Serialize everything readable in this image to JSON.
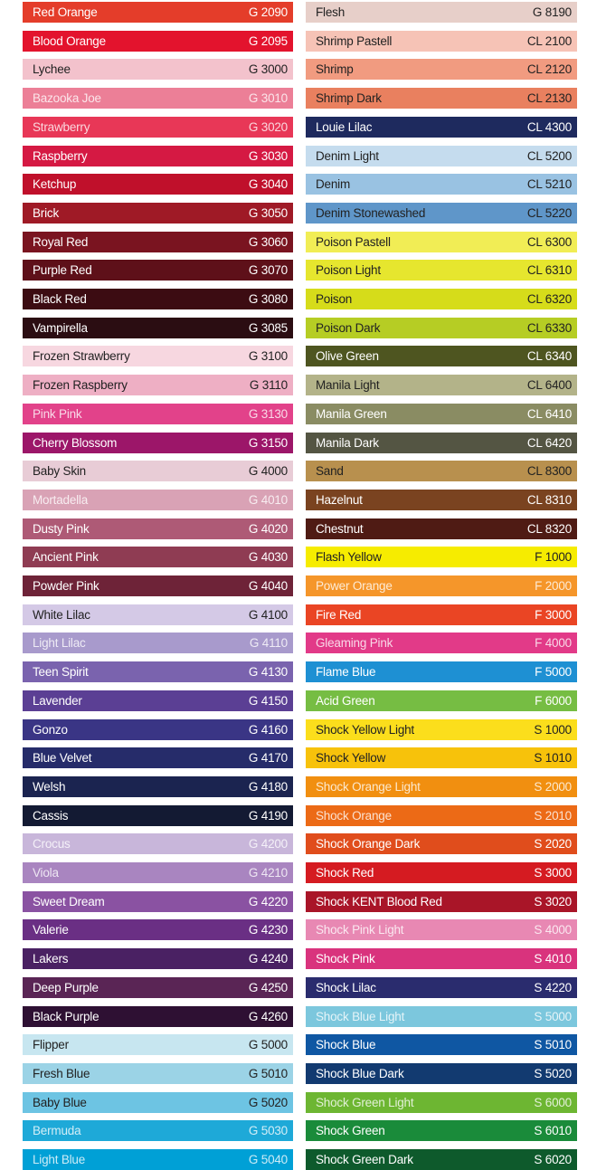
{
  "left_column": [
    {
      "name": "Red Orange",
      "code": "G 2090",
      "color": "#e43d2a",
      "text": "dark"
    },
    {
      "name": "Blood Orange",
      "code": "G 2095",
      "color": "#e3132d",
      "text": "dark"
    },
    {
      "name": "Lychee",
      "code": "G 3000",
      "color": "#f3c2cc",
      "text": "light"
    },
    {
      "name": "Bazooka Joe",
      "code": "G 3010",
      "color": "#ec7f97",
      "text": "faint"
    },
    {
      "name": "Strawberry",
      "code": "G 3020",
      "color": "#e83757",
      "text": "faint"
    },
    {
      "name": "Raspberry",
      "code": "G 3030",
      "color": "#d51943",
      "text": "dark"
    },
    {
      "name": "Ketchup",
      "code": "G 3040",
      "color": "#c0102b",
      "text": "dark"
    },
    {
      "name": "Brick",
      "code": "G 3050",
      "color": "#9f1a26",
      "text": "dark"
    },
    {
      "name": "Royal Red",
      "code": "G 3060",
      "color": "#7a1420",
      "text": "dark"
    },
    {
      "name": "Purple Red",
      "code": "G 3070",
      "color": "#5e1019",
      "text": "dark"
    },
    {
      "name": "Black Red",
      "code": "G 3080",
      "color": "#3c0c12",
      "text": "dark"
    },
    {
      "name": "Vampirella",
      "code": "G 3085",
      "color": "#2b0d12",
      "text": "dark"
    },
    {
      "name": "Frozen Strawberry",
      "code": "G 3100",
      "color": "#f7d7e0",
      "text": "light"
    },
    {
      "name": "Frozen Raspberry",
      "code": "G 3110",
      "color": "#eeafc4",
      "text": "light"
    },
    {
      "name": "Pink Pink",
      "code": "G 3130",
      "color": "#e2428a",
      "text": "faint"
    },
    {
      "name": "Cherry Blossom",
      "code": "G 3150",
      "color": "#9c1669",
      "text": "dark"
    },
    {
      "name": "Baby Skin",
      "code": "G 4000",
      "color": "#e8ccd6",
      "text": "light"
    },
    {
      "name": "Mortadella",
      "code": "G 4010",
      "color": "#d9a2b5",
      "text": "faint"
    },
    {
      "name": "Dusty Pink",
      "code": "G 4020",
      "color": "#ae5a76",
      "text": "dark"
    },
    {
      "name": "Ancient Pink",
      "code": "G 4030",
      "color": "#8f3c53",
      "text": "dark"
    },
    {
      "name": "Powder Pink",
      "code": "G 4040",
      "color": "#6e2338",
      "text": "dark"
    },
    {
      "name": "White Lilac",
      "code": "G 4100",
      "color": "#d4c9e6",
      "text": "light"
    },
    {
      "name": "Light Lilac",
      "code": "G 4110",
      "color": "#a89acc",
      "text": "faint"
    },
    {
      "name": "Teen Spirit",
      "code": "G 4130",
      "color": "#7a63ae",
      "text": "dark"
    },
    {
      "name": "Lavender",
      "code": "G 4150",
      "color": "#5b3f94",
      "text": "dark"
    },
    {
      "name": "Gonzo",
      "code": "G 4160",
      "color": "#3a3585",
      "text": "dark"
    },
    {
      "name": "Blue Velvet",
      "code": "G 4170",
      "color": "#262c6a",
      "text": "dark"
    },
    {
      "name": "Welsh",
      "code": "G 4180",
      "color": "#1b2450",
      "text": "dark"
    },
    {
      "name": "Cassis",
      "code": "G 4190",
      "color": "#131a33",
      "text": "dark"
    },
    {
      "name": "Crocus",
      "code": "G 4200",
      "color": "#c8b6da",
      "text": "faint"
    },
    {
      "name": "Viola",
      "code": "G 4210",
      "color": "#a985c0",
      "text": "faint"
    },
    {
      "name": "Sweet Dream",
      "code": "G 4220",
      "color": "#8a52a2",
      "text": "dark"
    },
    {
      "name": "Valerie",
      "code": "G 4230",
      "color": "#6a2f84",
      "text": "dark"
    },
    {
      "name": "Lakers",
      "code": "G 4240",
      "color": "#4a2163",
      "text": "dark"
    },
    {
      "name": "Deep Purple",
      "code": "G 4250",
      "color": "#5a2555",
      "text": "dark"
    },
    {
      "name": "Black Purple",
      "code": "G 4260",
      "color": "#2e1033",
      "text": "dark"
    },
    {
      "name": "Flipper",
      "code": "G 5000",
      "color": "#c7e6f0",
      "text": "light"
    },
    {
      "name": "Fresh Blue",
      "code": "G 5010",
      "color": "#9bd3e6",
      "text": "light"
    },
    {
      "name": "Baby Blue",
      "code": "G 5020",
      "color": "#6dc4e3",
      "text": "light"
    },
    {
      "name": "Bermuda",
      "code": "G 5030",
      "color": "#1ea9d8",
      "text": "faint"
    },
    {
      "name": "Light Blue",
      "code": "G 5040",
      "color": "#00a0d6",
      "text": "faint"
    }
  ],
  "right_column": [
    {
      "name": "Flesh",
      "code": "G 8190",
      "color": "#e7cfc9",
      "text": "light"
    },
    {
      "name": "Shrimp Pastell",
      "code": "CL 2100",
      "color": "#f6c3b6",
      "text": "light"
    },
    {
      "name": "Shrimp",
      "code": "CL 2120",
      "color": "#f19b80",
      "text": "light"
    },
    {
      "name": "Shrimp Dark",
      "code": "CL 2130",
      "color": "#e9805f",
      "text": "light"
    },
    {
      "name": "Louie Lilac",
      "code": "CL 4300",
      "color": "#1e2a5e",
      "text": "dark"
    },
    {
      "name": "Denim Light",
      "code": "CL 5200",
      "color": "#c5dcee",
      "text": "light"
    },
    {
      "name": "Denim",
      "code": "CL 5210",
      "color": "#99c2e2",
      "text": "light"
    },
    {
      "name": "Denim Stonewashed",
      "code": "CL 5220",
      "color": "#5f96c9",
      "text": "light"
    },
    {
      "name": "Poison Pastell",
      "code": "CL 6300",
      "color": "#f1ed55",
      "text": "light"
    },
    {
      "name": "Poison Light",
      "code": "CL 6310",
      "color": "#e6e62e",
      "text": "light"
    },
    {
      "name": "Poison",
      "code": "CL 6320",
      "color": "#d6dc1a",
      "text": "light"
    },
    {
      "name": "Poison Dark",
      "code": "CL 6330",
      "color": "#b6cd24",
      "text": "light"
    },
    {
      "name": "Olive Green",
      "code": "CL 6340",
      "color": "#4e5520",
      "text": "dark"
    },
    {
      "name": "Manila Light",
      "code": "CL 6400",
      "color": "#b3b389",
      "text": "light"
    },
    {
      "name": "Manila Green",
      "code": "CL 6410",
      "color": "#8a8c63",
      "text": "dark"
    },
    {
      "name": "Manila Dark",
      "code": "CL 6420",
      "color": "#545543",
      "text": "dark"
    },
    {
      "name": "Sand",
      "code": "CL 8300",
      "color": "#b8904e",
      "text": "light"
    },
    {
      "name": "Hazelnut",
      "code": "CL 8310",
      "color": "#7a4320",
      "text": "dark"
    },
    {
      "name": "Chestnut",
      "code": "CL 8320",
      "color": "#4f1b14",
      "text": "dark"
    },
    {
      "name": "Flash Yellow",
      "code": "F 1000",
      "color": "#f6ec00",
      "text": "light"
    },
    {
      "name": "Power Orange",
      "code": "F 2000",
      "color": "#f5962a",
      "text": "faint"
    },
    {
      "name": "Fire Red",
      "code": "F 3000",
      "color": "#ea4524",
      "text": "dark"
    },
    {
      "name": "Gleaming Pink",
      "code": "F 4000",
      "color": "#e23a88",
      "text": "faint"
    },
    {
      "name": "Flame Blue",
      "code": "F 5000",
      "color": "#1e90d3",
      "text": "dark"
    },
    {
      "name": "Acid Green",
      "code": "F 6000",
      "color": "#76bd43",
      "text": "dark"
    },
    {
      "name": "Shock Yellow Light",
      "code": "S 1000",
      "color": "#fbde1c",
      "text": "light"
    },
    {
      "name": "Shock Yellow",
      "code": "S 1010",
      "color": "#f7c20b",
      "text": "light"
    },
    {
      "name": "Shock Orange Light",
      "code": "S 2000",
      "color": "#f18f10",
      "text": "faint"
    },
    {
      "name": "Shock Orange",
      "code": "S 2010",
      "color": "#ec6a16",
      "text": "faint"
    },
    {
      "name": "Shock Orange Dark",
      "code": "S 2020",
      "color": "#e04d1c",
      "text": "dark"
    },
    {
      "name": "Shock Red",
      "code": "S 3000",
      "color": "#d51b21",
      "text": "dark"
    },
    {
      "name": "Shock KENT Blood Red",
      "code": "S 3020",
      "color": "#a91528",
      "text": "dark"
    },
    {
      "name": "Shock Pink Light",
      "code": "S 4000",
      "color": "#e888b3",
      "text": "faint"
    },
    {
      "name": "Shock Pink",
      "code": "S 4010",
      "color": "#d9337d",
      "text": "dark"
    },
    {
      "name": "Shock Lilac",
      "code": "S 4220",
      "color": "#2a2c6e",
      "text": "dark"
    },
    {
      "name": "Shock Blue Light",
      "code": "S 5000",
      "color": "#7cc7dd",
      "text": "faint"
    },
    {
      "name": "Shock Blue",
      "code": "S 5010",
      "color": "#0f57a3",
      "text": "dark"
    },
    {
      "name": "Shock Blue Dark",
      "code": "S 5020",
      "color": "#123a70",
      "text": "dark"
    },
    {
      "name": "Shock Green Light",
      "code": "S 6000",
      "color": "#6db632",
      "text": "faint"
    },
    {
      "name": "Shock Green",
      "code": "S 6010",
      "color": "#1a8b3a",
      "text": "dark"
    },
    {
      "name": "Shock Green Dark",
      "code": "S 6020",
      "color": "#0e5a2c",
      "text": "dark"
    }
  ]
}
